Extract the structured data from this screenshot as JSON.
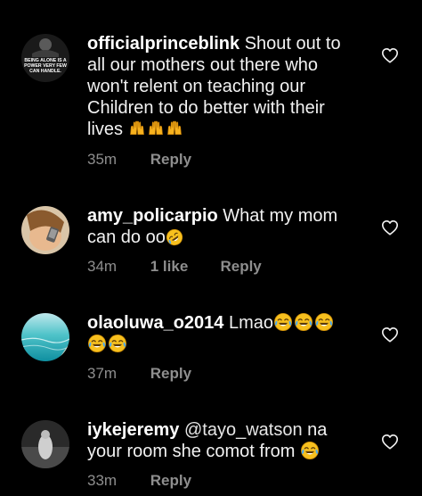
{
  "comments": [
    {
      "username": "officialprinceblink",
      "text": "Shout out to all our mothers out there who won't relent on teaching our Children to do better with their lives",
      "emoji": "raised-hands-emoji x3",
      "time": "35m",
      "likes": "",
      "reply": "Reply",
      "avatar_caption": [
        "BEING ALONE IS A",
        "POWER VERY FEW",
        "CAN HANDLE."
      ]
    },
    {
      "username": "amy_policarpio",
      "text": "What my mom can do oo",
      "emoji": "rolling-on-floor-laughing-emoji",
      "time": "34m",
      "likes": "1 like",
      "reply": "Reply"
    },
    {
      "username": "olaoluwa_o2014",
      "text": "Lmao",
      "emoji": "tears-of-joy-emoji x5",
      "time": "37m",
      "likes": "",
      "reply": "Reply"
    },
    {
      "username": "iykejeremy",
      "mention": "@tayo_watson",
      "text": "na your room she comot from",
      "emoji": "tears-of-joy-emoji",
      "time": "33m",
      "likes": "",
      "reply": "Reply"
    }
  ],
  "icons": {
    "like": "heart-outline-icon"
  },
  "colors": {
    "background": "#000000",
    "text": "#f2f2f2",
    "meta": "#8e8e8e",
    "emoji_yellow": "#f7c01e"
  }
}
